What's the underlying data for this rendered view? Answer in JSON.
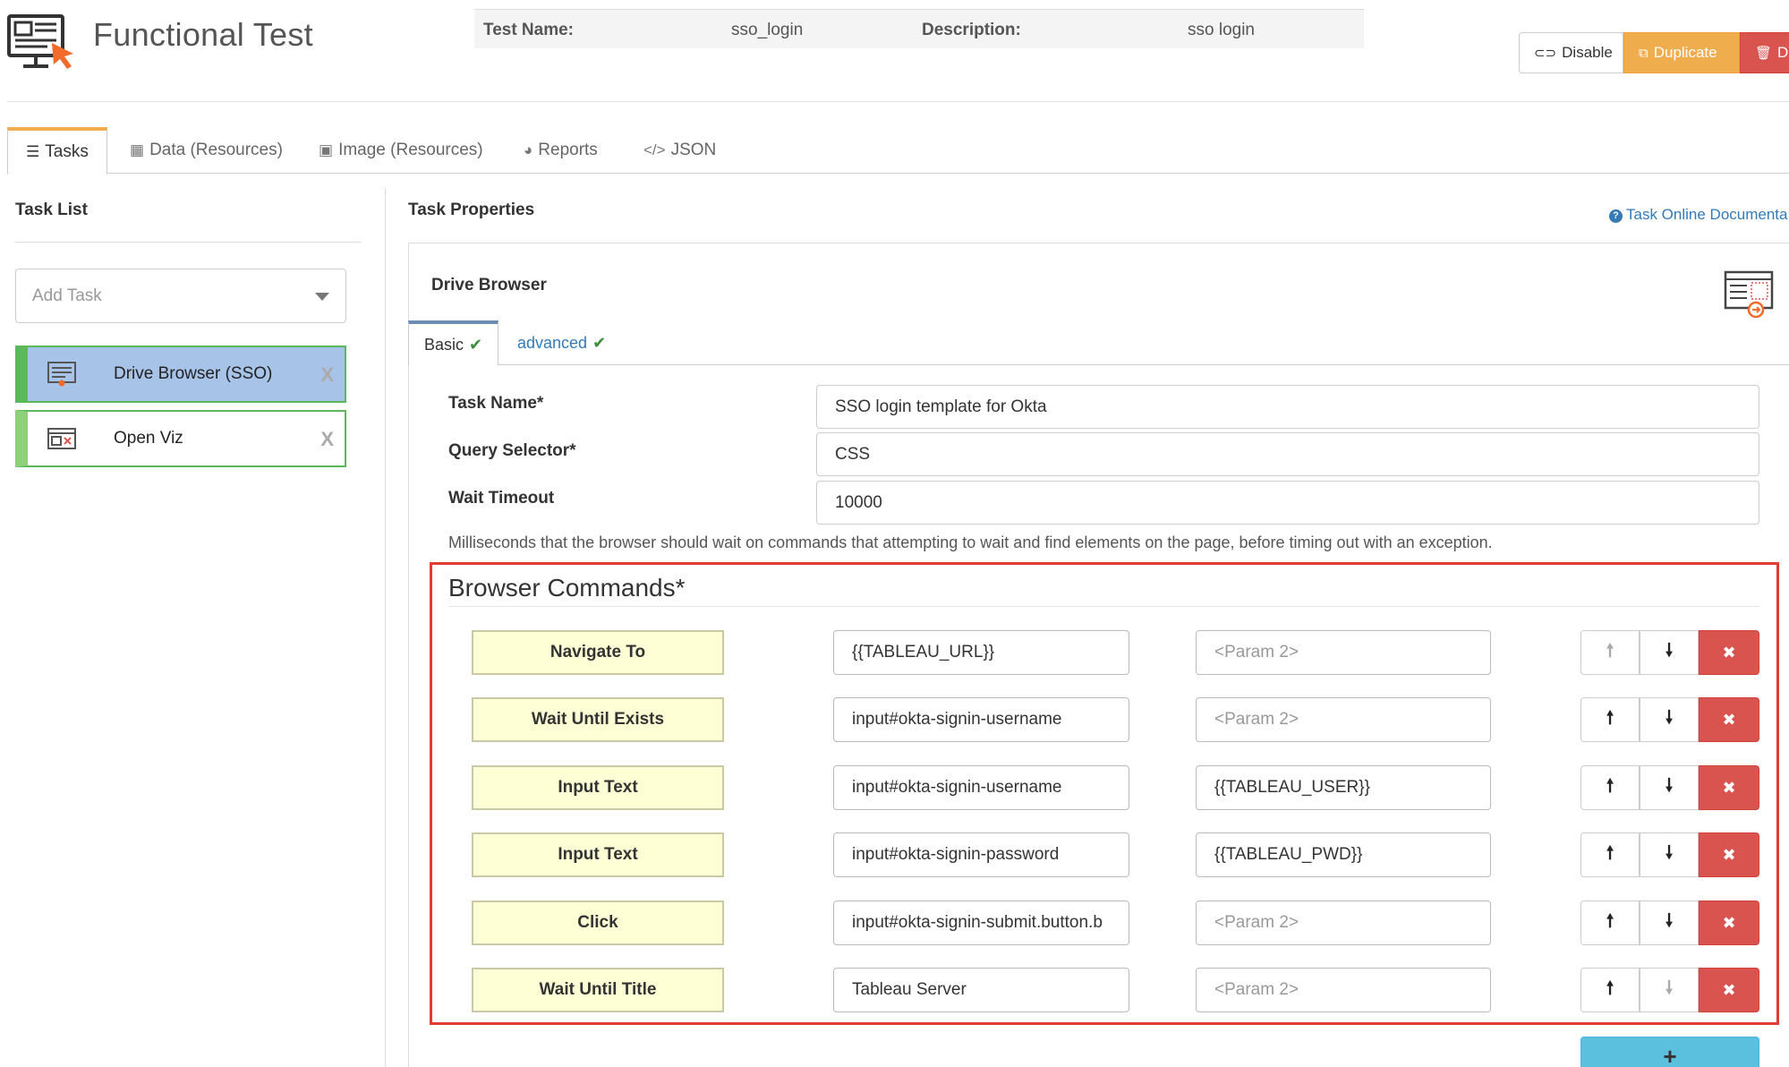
{
  "app": {
    "title": "Functional Test"
  },
  "test_info": {
    "name_label": "Test Name:",
    "name_value": "sso_login",
    "desc_label": "Description:",
    "desc_value": "sso login"
  },
  "header_buttons": {
    "disable": "Disable",
    "duplicate": "Duplicate",
    "delete": "De"
  },
  "tabs": [
    {
      "label": "Tasks",
      "icon": "list-icon",
      "active": true
    },
    {
      "label": "Data (Resources)",
      "icon": "table-icon"
    },
    {
      "label": "Image (Resources)",
      "icon": "image-icon"
    },
    {
      "label": "Reports",
      "icon": "pie-chart-icon"
    },
    {
      "label": "JSON",
      "icon": "code-icon"
    }
  ],
  "task_list": {
    "title": "Task List",
    "add_placeholder": "Add Task",
    "items": [
      {
        "name": "Drive Browser (SSO)",
        "selected": true,
        "icon": "browser-task-icon",
        "remove": "X"
      },
      {
        "name": "Open Viz",
        "selected": false,
        "icon": "viz-task-icon",
        "remove": "X"
      }
    ]
  },
  "task_properties": {
    "title": "Task Properties",
    "doc_link": "Task Online Documenta",
    "task_type": "Drive Browser",
    "sub_tabs": {
      "basic": "Basic",
      "advanced": "advanced"
    },
    "fields": {
      "task_name_label": "Task Name*",
      "task_name_value": "SSO login template for Okta",
      "query_selector_label": "Query Selector*",
      "query_selector_value": "CSS",
      "wait_timeout_label": "Wait Timeout",
      "wait_timeout_value": "10000"
    },
    "help_text": "Milliseconds that the browser should wait on commands that attempting to wait and find elements on the page, before timing out with an exception."
  },
  "browser_commands": {
    "title": "Browser Commands*",
    "param2_placeholder": "<Param 2>",
    "add_label": "+",
    "up_glyph": "🠕",
    "down_glyph": "🠗",
    "delete_glyph": "✖",
    "rows": [
      {
        "command": "Navigate To",
        "param1": "{{TABLEAU_URL}}",
        "param2": "",
        "up_disabled": true,
        "down_disabled": false
      },
      {
        "command": "Wait Until Exists",
        "param1": "input#okta-signin-username",
        "param2": "",
        "up_disabled": false,
        "down_disabled": false
      },
      {
        "command": "Input Text",
        "param1": "input#okta-signin-username",
        "param2": "{{TABLEAU_USER}}",
        "up_disabled": false,
        "down_disabled": false
      },
      {
        "command": "Input Text",
        "param1": "input#okta-signin-password",
        "param2": "{{TABLEAU_PWD}}",
        "up_disabled": false,
        "down_disabled": false
      },
      {
        "command": "Click",
        "param1": "input#okta-signin-submit.button.b",
        "param2": "",
        "up_disabled": false,
        "down_disabled": false
      },
      {
        "command": "Wait Until Title",
        "param1": "Tableau Server",
        "param2": "",
        "up_disabled": false,
        "down_disabled": true
      }
    ]
  },
  "colors": {
    "accent_orange": "#f0ad4e",
    "danger_red": "#d9534f",
    "info_blue": "#5bc0de",
    "link_blue": "#337ab7",
    "selected_task": "#a7c3e8",
    "command_bg": "#ffffd6",
    "highlight_box": "#e03c31"
  }
}
